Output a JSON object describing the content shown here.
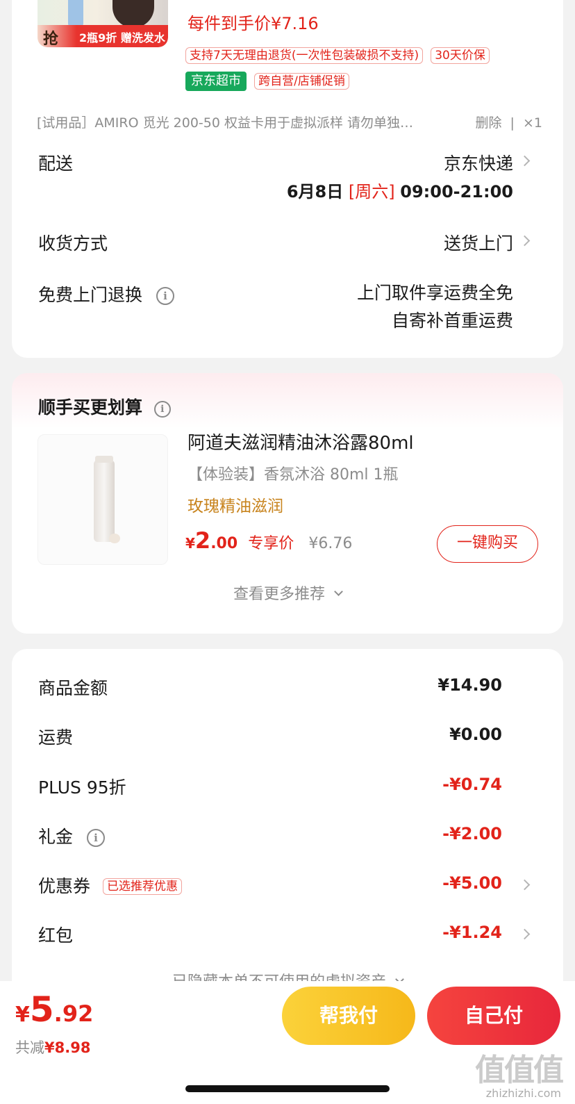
{
  "product_top": {
    "image_badge_char": "抢",
    "image_badge_text": "2瓶9折 赠洗发水",
    "price_label": "每件到手价¥7.16",
    "tags": [
      "支持7天无理由退货(一次性包装破损不支持)",
      "30天价保"
    ],
    "store_tag": "京东超市",
    "promo_tag": "跨自营/店铺促销"
  },
  "trial_item": {
    "title": "[试用品］AMIRO 觅光 200-50 权益卡用于虚拟派样 请勿单独…",
    "delete": "删除",
    "qty": "×1"
  },
  "delivery": {
    "label": "配送",
    "carrier": "京东快递",
    "date": "6月8日",
    "weekday": "[周六]",
    "time": "09:00-21:00"
  },
  "receive": {
    "label": "收货方式",
    "value": "送货上门"
  },
  "return": {
    "label": "免费上门退换",
    "line1": "上门取件享运费全免",
    "line2": "自寄补首重运费"
  },
  "recommend": {
    "title": "顺手买更划算",
    "name": "阿道夫滋润精油沐浴露80ml",
    "spec_tag": "【体验装】",
    "spec": "香氛沐浴  80ml 1瓶",
    "feature": "玫瑰精油滋润",
    "price_symbol": "¥",
    "price_int": "2",
    "price_dec": ".00",
    "price_label": "专享价",
    "orig_price": "¥6.76",
    "buy_button": "一键购买",
    "more": "查看更多推荐"
  },
  "summary": {
    "rows": [
      {
        "label": "商品金额",
        "value": "¥14.90"
      },
      {
        "label": "运费",
        "value": "¥0.00"
      },
      {
        "label": "PLUS 95折",
        "value": "-¥0.74"
      },
      {
        "label": "礼金",
        "value": "-¥2.00"
      },
      {
        "label": "优惠券",
        "value": "-¥5.00",
        "tag": "已选推荐优惠"
      },
      {
        "label": "红包",
        "value": "-¥1.24"
      }
    ],
    "hidden_note": "已隐藏本单不可使用的虚拟资产"
  },
  "footer": {
    "currency": "¥",
    "total_int": "5",
    "total_dec": ".92",
    "saved_label": "共减",
    "saved_value": "¥8.98",
    "help_pay": "帮我付",
    "self_pay": "自己付"
  },
  "watermark": {
    "logo": "值值值",
    "url": "zhizhizhi.com"
  },
  "colors": {
    "accent_red": "#e2231a",
    "store_green": "#17a85b",
    "help_pay_yellow": "#f7c21e",
    "self_pay_red": "#ee2f3c"
  }
}
